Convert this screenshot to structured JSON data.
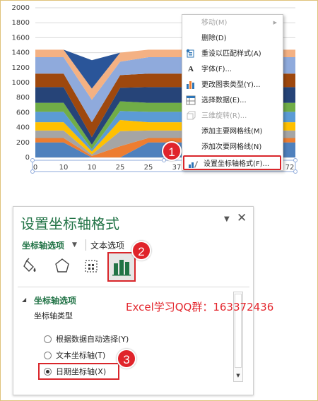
{
  "chart": {
    "y_ticks": [
      "2000",
      "1800",
      "1600",
      "1400",
      "1200",
      "1000",
      "800",
      "600",
      "400",
      "200",
      "0"
    ],
    "x_ticks": [
      "0",
      "10",
      "10",
      "25",
      "25",
      "37",
      "72"
    ],
    "colors": [
      "#4f81bd",
      "#ed7d31",
      "#a5a5a5",
      "#ffc000",
      "#5b9bd5",
      "#70ad47",
      "#264478",
      "#9e480e",
      "#636363",
      "#997300",
      "#1f5fa8"
    ]
  },
  "context_menu": {
    "items": [
      {
        "label": "移动(M)",
        "icon": "",
        "disabled": true,
        "has_submenu": true
      },
      {
        "label": "删除(D)",
        "icon": "",
        "disabled": false
      },
      {
        "label": "重设以匹配样式(A)",
        "icon": "reset-style-icon",
        "disabled": false
      },
      {
        "label": "字体(F)...",
        "icon": "font-icon",
        "disabled": false
      },
      {
        "label": "更改图表类型(Y)...",
        "icon": "chart-type-icon",
        "disabled": false
      },
      {
        "label": "选择数据(E)...",
        "icon": "select-data-icon",
        "disabled": false
      },
      {
        "label": "三维旋转(R)...",
        "icon": "3d-rotation-icon",
        "disabled": true
      },
      {
        "label": "添加主要网格线(M)",
        "icon": "",
        "disabled": false
      },
      {
        "label": "添加次要网格线(N)",
        "icon": "",
        "disabled": false
      },
      {
        "label": "设置坐标轴格式(F)...",
        "icon": "format-axis-icon",
        "disabled": false,
        "highlighted": true
      }
    ]
  },
  "badges": [
    "1",
    "2",
    "3"
  ],
  "pane": {
    "title": "设置坐标轴格式",
    "tab_axis_options": "坐标轴选项",
    "tab_text_options": "文本选项",
    "section_title": "坐标轴选项",
    "axis_type_label": "坐标轴类型",
    "options": [
      {
        "label": "根据数据自动选择(Y)",
        "selected": false
      },
      {
        "label": "文本坐标轴(T)",
        "selected": false
      },
      {
        "label": "日期坐标轴(X)",
        "selected": true
      }
    ]
  },
  "watermark": "Excel学习QQ群：163372436",
  "accent": "#217346",
  "highlight": "#d9262b"
}
